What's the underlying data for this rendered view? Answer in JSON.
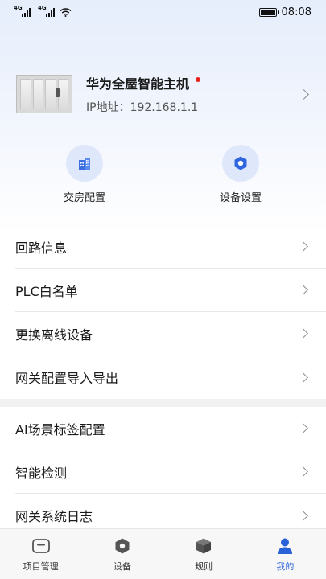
{
  "status_bar": {
    "network_1": "4G",
    "network_2": "4G",
    "time": "08:08"
  },
  "device": {
    "name": "华为全屋智能主机",
    "ip": "IP地址：192.168.1.1"
  },
  "quick_actions": [
    {
      "label": "交房配置",
      "icon": "building-icon"
    },
    {
      "label": "设备设置",
      "icon": "hexagon-settings-icon"
    }
  ],
  "menu_group_1": [
    {
      "label": "回路信息"
    },
    {
      "label": "PLC白名单"
    },
    {
      "label": "更换离线设备"
    },
    {
      "label": "网关配置导入导出"
    }
  ],
  "menu_group_2": [
    {
      "label": "AI场景标签配置"
    },
    {
      "label": "智能检测"
    },
    {
      "label": "网关系统日志"
    }
  ],
  "bottom_nav": [
    {
      "label": "项目管理",
      "icon": "folder-icon",
      "active": false
    },
    {
      "label": "设备",
      "icon": "hexagon-icon",
      "active": false
    },
    {
      "label": "规则",
      "icon": "cube-icon",
      "active": false
    },
    {
      "label": "我的",
      "icon": "person-icon",
      "active": true
    }
  ],
  "colors": {
    "accent": "#2a62d8",
    "quick_action_bg": "#dfe8fb",
    "red_dot": "#e8231f"
  }
}
